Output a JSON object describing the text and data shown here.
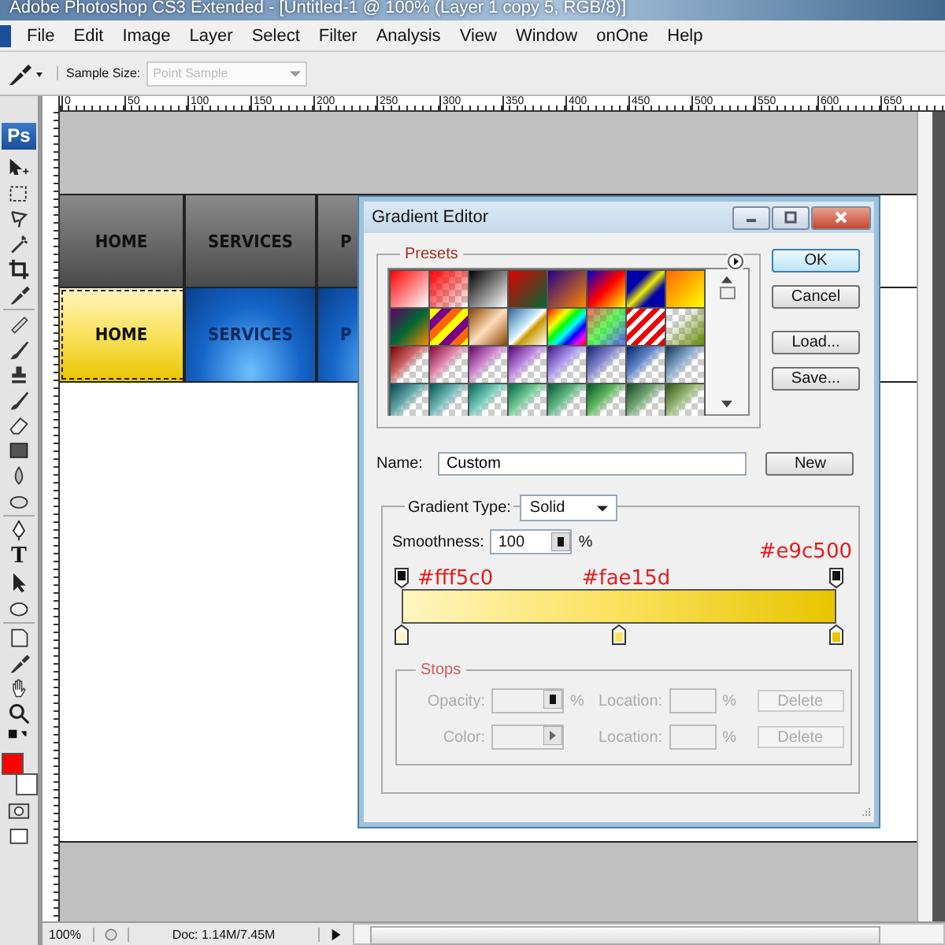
{
  "window": {
    "title": "Adobe Photoshop CS3 Extended - [Untitled-1 @ 100% (Layer 1 copy 5, RGB/8)]"
  },
  "menu": [
    "File",
    "Edit",
    "Image",
    "Layer",
    "Select",
    "Filter",
    "Analysis",
    "View",
    "Window",
    "onOne",
    "Help"
  ],
  "options_bar": {
    "sample_size_label": "Sample Size:",
    "sample_size": {
      "value": "Point Sample",
      "disabled": true
    }
  },
  "ruler": {
    "ticks": [
      "0",
      "50",
      "100",
      "150",
      "200",
      "250",
      "300",
      "350",
      "400",
      "450",
      "500",
      "550",
      "600",
      "650"
    ]
  },
  "toolbox": {
    "logo": "Ps",
    "type_tool": "T",
    "colors": [
      {
        "kind": "foreground",
        "color": "#ff0000"
      },
      {
        "kind": "background",
        "color": "#ffffff"
      }
    ]
  },
  "document": {
    "nav_rows": [
      {
        "kind": "normal",
        "items": [
          {
            "label": "HOME",
            "selected": false
          },
          {
            "label": "SERVICES",
            "selected": false
          },
          {
            "label": "P",
            "selected": false
          }
        ]
      },
      {
        "kind": "hover",
        "items": [
          {
            "label": "HOME",
            "selected": true
          },
          {
            "label": "SERVICES",
            "selected": false
          },
          {
            "label": "P",
            "selected": false
          }
        ]
      }
    ]
  },
  "status_bar": {
    "zoom": "100%",
    "doc": "Doc: 1.14M/7.45M"
  },
  "dialog": {
    "title": "Gradient Editor",
    "presets_label": "Presets",
    "buttons": [
      {
        "label": "OK",
        "default": true
      },
      {
        "label": "Cancel",
        "default": false
      },
      {
        "label": "Load...",
        "default": false
      },
      {
        "label": "Save...",
        "default": false
      }
    ],
    "name_label": "Name:",
    "name": "Custom",
    "new_button": "New",
    "gradient_type_label": "Gradient Type:",
    "gradient_type": "Solid",
    "smoothness_label": "Smoothness:",
    "smoothness": "100",
    "smoothness_unit": "%",
    "opacity_stops": [
      {
        "level": 0
      },
      {
        "level": 1
      }
    ],
    "color_stops": [
      {
        "level": 0,
        "color": "#fff5c0",
        "label": "#fff5c0"
      },
      {
        "level": 0.5,
        "color": "#fae15d",
        "label": "#fae15d"
      },
      {
        "level": 1,
        "color": "#e9c500",
        "label": "#e9c500"
      }
    ],
    "stops": {
      "label": "Stops",
      "rows": [
        {
          "kind": "opacity",
          "label": "Opacity:",
          "unit": "%",
          "location_label": "Location:",
          "location_unit": "%",
          "delete": "Delete",
          "disabled": true
        },
        {
          "kind": "color",
          "label": "Color:",
          "location_label": "Location:",
          "location_unit": "%",
          "delete": "Delete",
          "disabled": true
        }
      ]
    }
  }
}
